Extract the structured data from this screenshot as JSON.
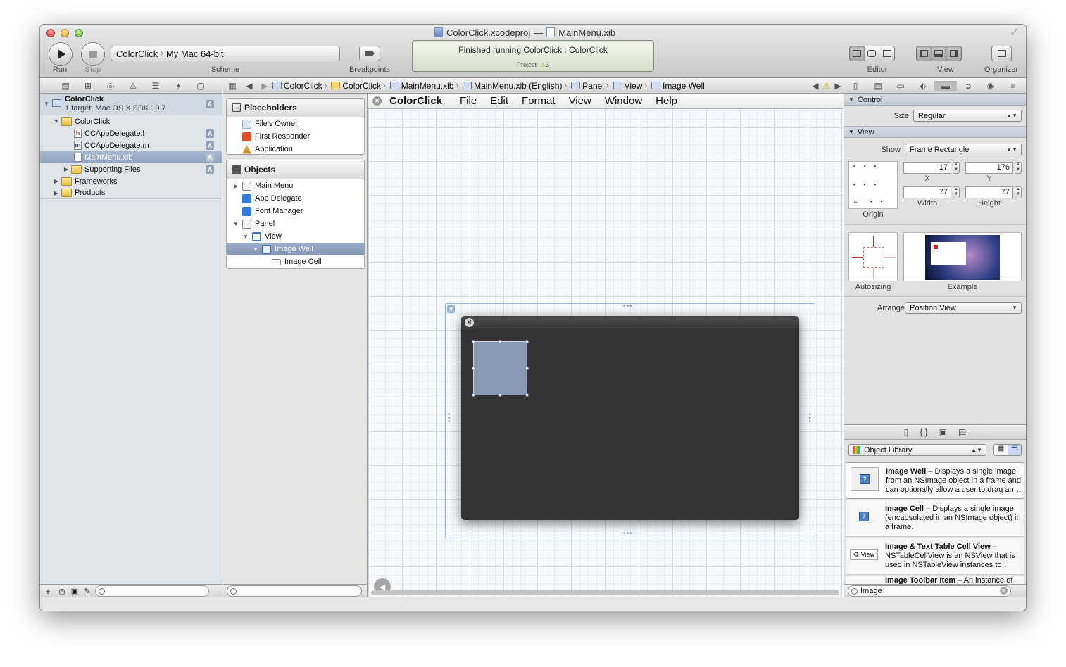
{
  "window": {
    "project_file": "ColorClick.xcodeproj",
    "separator": "—",
    "document_file": "MainMenu.xib"
  },
  "toolbar": {
    "run_label": "Run",
    "stop_label": "Stop",
    "scheme_label": "Scheme",
    "scheme_target": "ColorClick",
    "scheme_destination": "My Mac 64-bit",
    "breakpoints_label": "Breakpoints",
    "editor_label": "Editor",
    "view_label": "View",
    "organizer_label": "Organizer"
  },
  "activity": {
    "status": "Finished running ColorClick : ColorClick",
    "project_label": "Project",
    "warning_count": "3"
  },
  "jumpbar": {
    "crumbs": [
      "ColorClick",
      "ColorClick",
      "MainMenu.xib",
      "MainMenu.xib (English)",
      "Panel",
      "View",
      "Image Well"
    ]
  },
  "navigator": {
    "project_name": "ColorClick",
    "project_subtitle": "1 target, Mac OS X SDK 10.7",
    "group_name": "ColorClick",
    "files": [
      {
        "name": "CCAppDelegate.h",
        "type_letter": "h",
        "badge": "A"
      },
      {
        "name": "CCAppDelegate.m",
        "type_letter": "m",
        "badge": "A"
      },
      {
        "name": "MainMenu.xib",
        "type_letter": "",
        "badge": "A"
      }
    ],
    "supporting_files": "Supporting Files",
    "supporting_badge": "A",
    "project_badge": "A",
    "frameworks": "Frameworks",
    "products": "Products"
  },
  "outline": {
    "placeholders_title": "Placeholders",
    "placeholders": [
      "File's Owner",
      "First Responder",
      "Application"
    ],
    "objects_title": "Objects",
    "objects": [
      "Main Menu",
      "App Delegate",
      "Font Manager",
      "Panel",
      "View",
      "Image Well",
      "Image Cell"
    ]
  },
  "canvas": {
    "menu": {
      "app": "ColorClick",
      "items": [
        "File",
        "Edit",
        "Format",
        "View",
        "Window",
        "Help"
      ]
    }
  },
  "inspector": {
    "control_title": "Control",
    "size_label": "Size",
    "size_value": "Regular",
    "view_title": "View",
    "show_label": "Show",
    "show_value": "Frame Rectangle",
    "x_value": "17",
    "y_value": "176",
    "width_value": "77",
    "height_value": "77",
    "x_label": "X",
    "y_label": "Y",
    "width_label": "Width",
    "height_label": "Height",
    "origin_label": "Origin",
    "autosizing_label": "Autosizing",
    "example_label": "Example",
    "arrange_label": "Arrange",
    "arrange_value": "Position View"
  },
  "library": {
    "selector_value": "Object Library",
    "items": [
      {
        "title": "Image Well",
        "desc": " – Displays a single image from an NSImage object in a frame and can optionally allow a user to drag an…"
      },
      {
        "title": "Image Cell",
        "desc": " – Displays a single image (encapsulated in an NSImage object) in a frame."
      },
      {
        "title": "Image & Text Table Cell View",
        "desc": " – NSTableCellView is an NSView that is used in NSTableView instances to…"
      },
      {
        "title": "Image Toolbar Item",
        "desc": " – An instance of"
      }
    ],
    "view_thumb_label": "View",
    "search_value": "Image"
  }
}
